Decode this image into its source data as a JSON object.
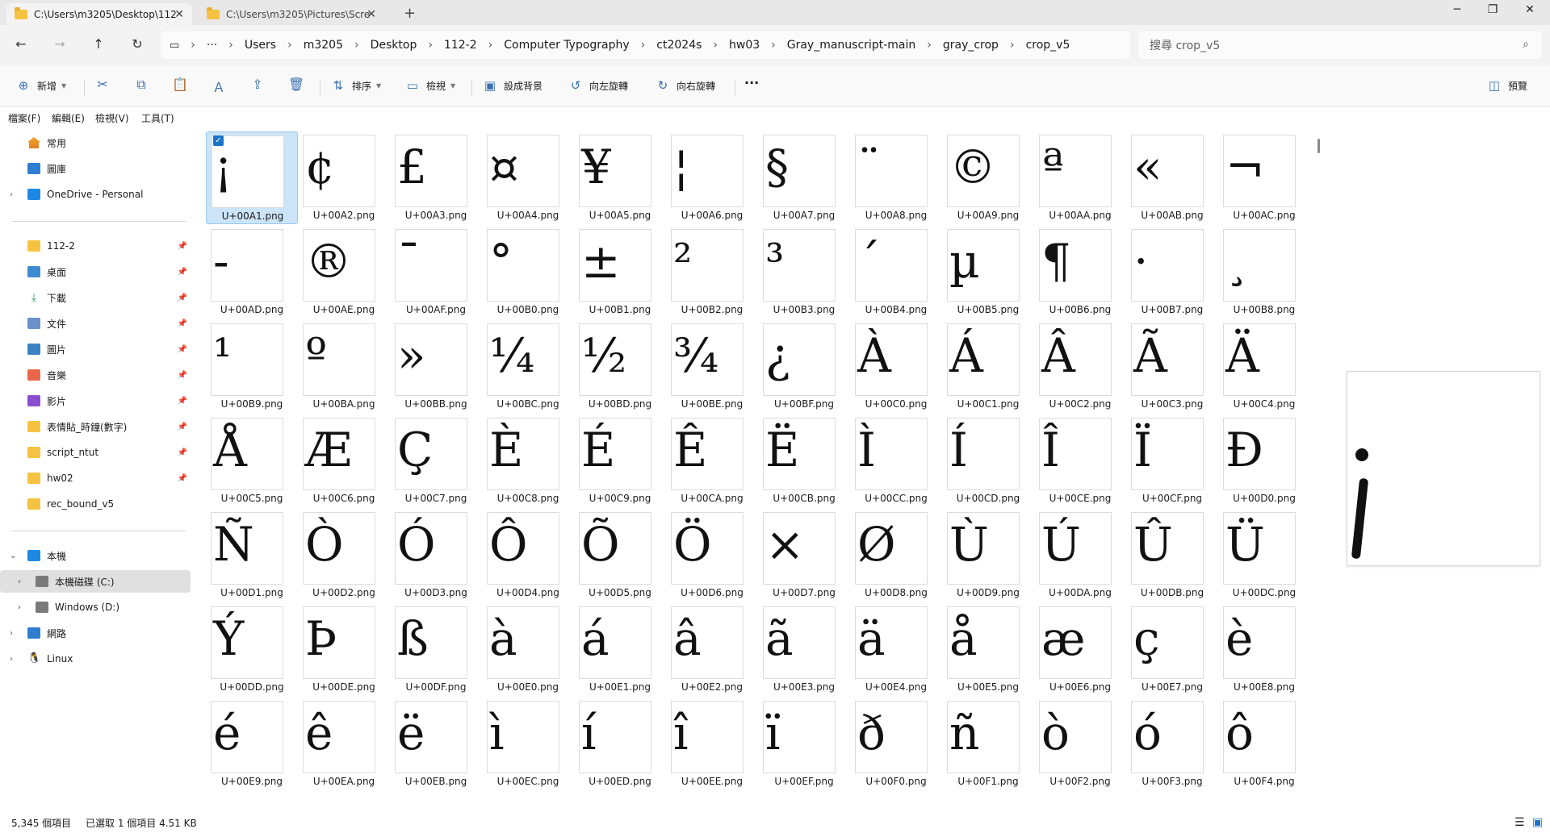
{
  "tabs": [
    {
      "label": "C:\\Users\\m3205\\Desktop\\112",
      "active": true
    },
    {
      "label": "C:\\Users\\m3205\\Pictures\\Scre",
      "active": false
    }
  ],
  "breadcrumb": [
    "Users",
    "m3205",
    "Desktop",
    "112-2",
    "Computer Typography",
    "ct2024s",
    "hw03",
    "Gray_manuscript-main",
    "gray_crop",
    "crop_v5"
  ],
  "search": {
    "placeholder": "搜尋 crop_v5"
  },
  "toolbar": {
    "new_label": "新增",
    "sort_label": "排序",
    "view_label": "檢視",
    "set_bg_label": "設成背景",
    "rotate_left_label": "向左旋轉",
    "rotate_right_label": "向右旋轉",
    "more_label": "···",
    "preview_label": "預覽"
  },
  "menu": [
    "檔案(F)",
    "編輯(E)",
    "檢視(V)",
    "工具(T)"
  ],
  "sidebar": {
    "items": [
      {
        "label": "常用",
        "icon": "home-icon"
      },
      {
        "label": "圖庫",
        "icon": "gallery-icon"
      },
      {
        "label": "OneDrive - Personal",
        "icon": "onedrive-icon"
      },
      {
        "label": "112-2",
        "icon": "folder-icon"
      },
      {
        "label": "桌面",
        "icon": "desktop-icon"
      },
      {
        "label": "下載",
        "icon": "download-icon"
      },
      {
        "label": "文件",
        "icon": "documents-icon"
      },
      {
        "label": "圖片",
        "icon": "pictures-icon"
      },
      {
        "label": "音樂",
        "icon": "music-icon"
      },
      {
        "label": "影片",
        "icon": "videos-icon"
      },
      {
        "label": "表情貼_時鐘(數字)",
        "icon": "folder-icon"
      },
      {
        "label": "script_ntut",
        "icon": "folder-icon"
      },
      {
        "label": "hw02",
        "icon": "folder-icon"
      },
      {
        "label": "rec_bound_v5",
        "icon": "folder-icon"
      },
      {
        "label": "本機",
        "icon": "this-pc-icon"
      },
      {
        "label": "本機磁碟 (C:)",
        "icon": "drive-icon"
      },
      {
        "label": "Windows (D:)",
        "icon": "drive-icon"
      },
      {
        "label": "網路",
        "icon": "network-icon"
      },
      {
        "label": "Linux",
        "icon": "linux-icon"
      }
    ]
  },
  "files": [
    {
      "name": "U+00A1.png",
      "glyph": "¡"
    },
    {
      "name": "U+00A2.png",
      "glyph": "¢"
    },
    {
      "name": "U+00A3.png",
      "glyph": "£"
    },
    {
      "name": "U+00A4.png",
      "glyph": "¤"
    },
    {
      "name": "U+00A5.png",
      "glyph": "¥"
    },
    {
      "name": "U+00A6.png",
      "glyph": "¦"
    },
    {
      "name": "U+00A7.png",
      "glyph": "§"
    },
    {
      "name": "U+00A8.png",
      "glyph": "¨"
    },
    {
      "name": "U+00A9.png",
      "glyph": "©"
    },
    {
      "name": "U+00AA.png",
      "glyph": "ª"
    },
    {
      "name": "U+00AB.png",
      "glyph": "«"
    },
    {
      "name": "U+00AC.png",
      "glyph": "¬"
    },
    {
      "name": "U+00AD.png",
      "glyph": "-"
    },
    {
      "name": "U+00AE.png",
      "glyph": "®"
    },
    {
      "name": "U+00AF.png",
      "glyph": "¯"
    },
    {
      "name": "U+00B0.png",
      "glyph": "°"
    },
    {
      "name": "U+00B1.png",
      "glyph": "±"
    },
    {
      "name": "U+00B2.png",
      "glyph": "²"
    },
    {
      "name": "U+00B3.png",
      "glyph": "³"
    },
    {
      "name": "U+00B4.png",
      "glyph": "´"
    },
    {
      "name": "U+00B5.png",
      "glyph": "µ"
    },
    {
      "name": "U+00B6.png",
      "glyph": "¶"
    },
    {
      "name": "U+00B7.png",
      "glyph": "·"
    },
    {
      "name": "U+00B8.png",
      "glyph": "¸"
    },
    {
      "name": "U+00B9.png",
      "glyph": "¹"
    },
    {
      "name": "U+00BA.png",
      "glyph": "º"
    },
    {
      "name": "U+00BB.png",
      "glyph": "»"
    },
    {
      "name": "U+00BC.png",
      "glyph": "¼"
    },
    {
      "name": "U+00BD.png",
      "glyph": "½"
    },
    {
      "name": "U+00BE.png",
      "glyph": "¾"
    },
    {
      "name": "U+00BF.png",
      "glyph": "¿"
    },
    {
      "name": "U+00C0.png",
      "glyph": "À"
    },
    {
      "name": "U+00C1.png",
      "glyph": "Á"
    },
    {
      "name": "U+00C2.png",
      "glyph": "Â"
    },
    {
      "name": "U+00C3.png",
      "glyph": "Ã"
    },
    {
      "name": "U+00C4.png",
      "glyph": "Ä"
    },
    {
      "name": "U+00C5.png",
      "glyph": "Å"
    },
    {
      "name": "U+00C6.png",
      "glyph": "Æ"
    },
    {
      "name": "U+00C7.png",
      "glyph": "Ç"
    },
    {
      "name": "U+00C8.png",
      "glyph": "È"
    },
    {
      "name": "U+00C9.png",
      "glyph": "É"
    },
    {
      "name": "U+00CA.png",
      "glyph": "Ê"
    },
    {
      "name": "U+00CB.png",
      "glyph": "Ë"
    },
    {
      "name": "U+00CC.png",
      "glyph": "Ì"
    },
    {
      "name": "U+00CD.png",
      "glyph": "Í"
    },
    {
      "name": "U+00CE.png",
      "glyph": "Î"
    },
    {
      "name": "U+00CF.png",
      "glyph": "Ï"
    },
    {
      "name": "U+00D0.png",
      "glyph": "Ð"
    },
    {
      "name": "U+00D1.png",
      "glyph": "Ñ"
    },
    {
      "name": "U+00D2.png",
      "glyph": "Ò"
    },
    {
      "name": "U+00D3.png",
      "glyph": "Ó"
    },
    {
      "name": "U+00D4.png",
      "glyph": "Ô"
    },
    {
      "name": "U+00D5.png",
      "glyph": "Õ"
    },
    {
      "name": "U+00D6.png",
      "glyph": "Ö"
    },
    {
      "name": "U+00D7.png",
      "glyph": "×"
    },
    {
      "name": "U+00D8.png",
      "glyph": "Ø"
    },
    {
      "name": "U+00D9.png",
      "glyph": "Ù"
    },
    {
      "name": "U+00DA.png",
      "glyph": "Ú"
    },
    {
      "name": "U+00DB.png",
      "glyph": "Û"
    },
    {
      "name": "U+00DC.png",
      "glyph": "Ü"
    },
    {
      "name": "U+00DD.png",
      "glyph": "Ý"
    },
    {
      "name": "U+00DE.png",
      "glyph": "Þ"
    },
    {
      "name": "U+00DF.png",
      "glyph": "ß"
    },
    {
      "name": "U+00E0.png",
      "glyph": "à"
    },
    {
      "name": "U+00E1.png",
      "glyph": "á"
    },
    {
      "name": "U+00E2.png",
      "glyph": "â"
    },
    {
      "name": "U+00E3.png",
      "glyph": "ã"
    },
    {
      "name": "U+00E4.png",
      "glyph": "ä"
    },
    {
      "name": "U+00E5.png",
      "glyph": "å"
    },
    {
      "name": "U+00E6.png",
      "glyph": "æ"
    },
    {
      "name": "U+00E7.png",
      "glyph": "ç"
    },
    {
      "name": "U+00E8.png",
      "glyph": "è"
    },
    {
      "name": "U+00E9.png",
      "glyph": "é"
    },
    {
      "name": "U+00EA.png",
      "glyph": "ê"
    },
    {
      "name": "U+00EB.png",
      "glyph": "ë"
    },
    {
      "name": "U+00EC.png",
      "glyph": "ì"
    },
    {
      "name": "U+00ED.png",
      "glyph": "í"
    },
    {
      "name": "U+00EE.png",
      "glyph": "î"
    },
    {
      "name": "U+00EF.png",
      "glyph": "ï"
    },
    {
      "name": "U+00F0.png",
      "glyph": "ð"
    },
    {
      "name": "U+00F1.png",
      "glyph": "ñ"
    },
    {
      "name": "U+00F2.png",
      "glyph": "ò"
    },
    {
      "name": "U+00F3.png",
      "glyph": "ó"
    },
    {
      "name": "U+00F4.png",
      "glyph": "ô"
    }
  ],
  "selected_index": 0,
  "status": {
    "item_count": "5,345 個項目",
    "selected": "已選取 1 個項目  4.51 KB"
  }
}
